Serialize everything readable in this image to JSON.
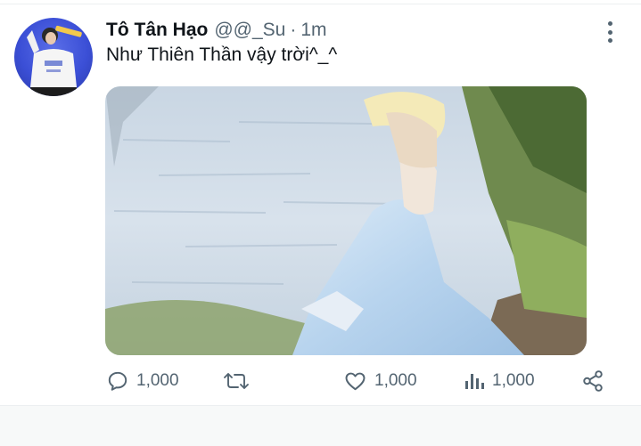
{
  "tweet": {
    "display_name": "Tô Tân Hạo",
    "handle": "@@_Su",
    "separator": "·",
    "time": "1m",
    "text": "Như Thiên Thần vậy trời^_^"
  },
  "actions": {
    "reply_count": "1,000",
    "like_count": "1,000",
    "views_count": "1,000"
  },
  "icons": {
    "more": "more-vertical-icon",
    "reply": "comment-icon",
    "retweet": "retweet-icon",
    "like": "heart-icon",
    "views": "analytics-icon",
    "share": "share-icon"
  },
  "colors": {
    "text_primary": "#0f1419",
    "text_secondary": "#536471",
    "avatar_background": "#3b4fd6"
  }
}
